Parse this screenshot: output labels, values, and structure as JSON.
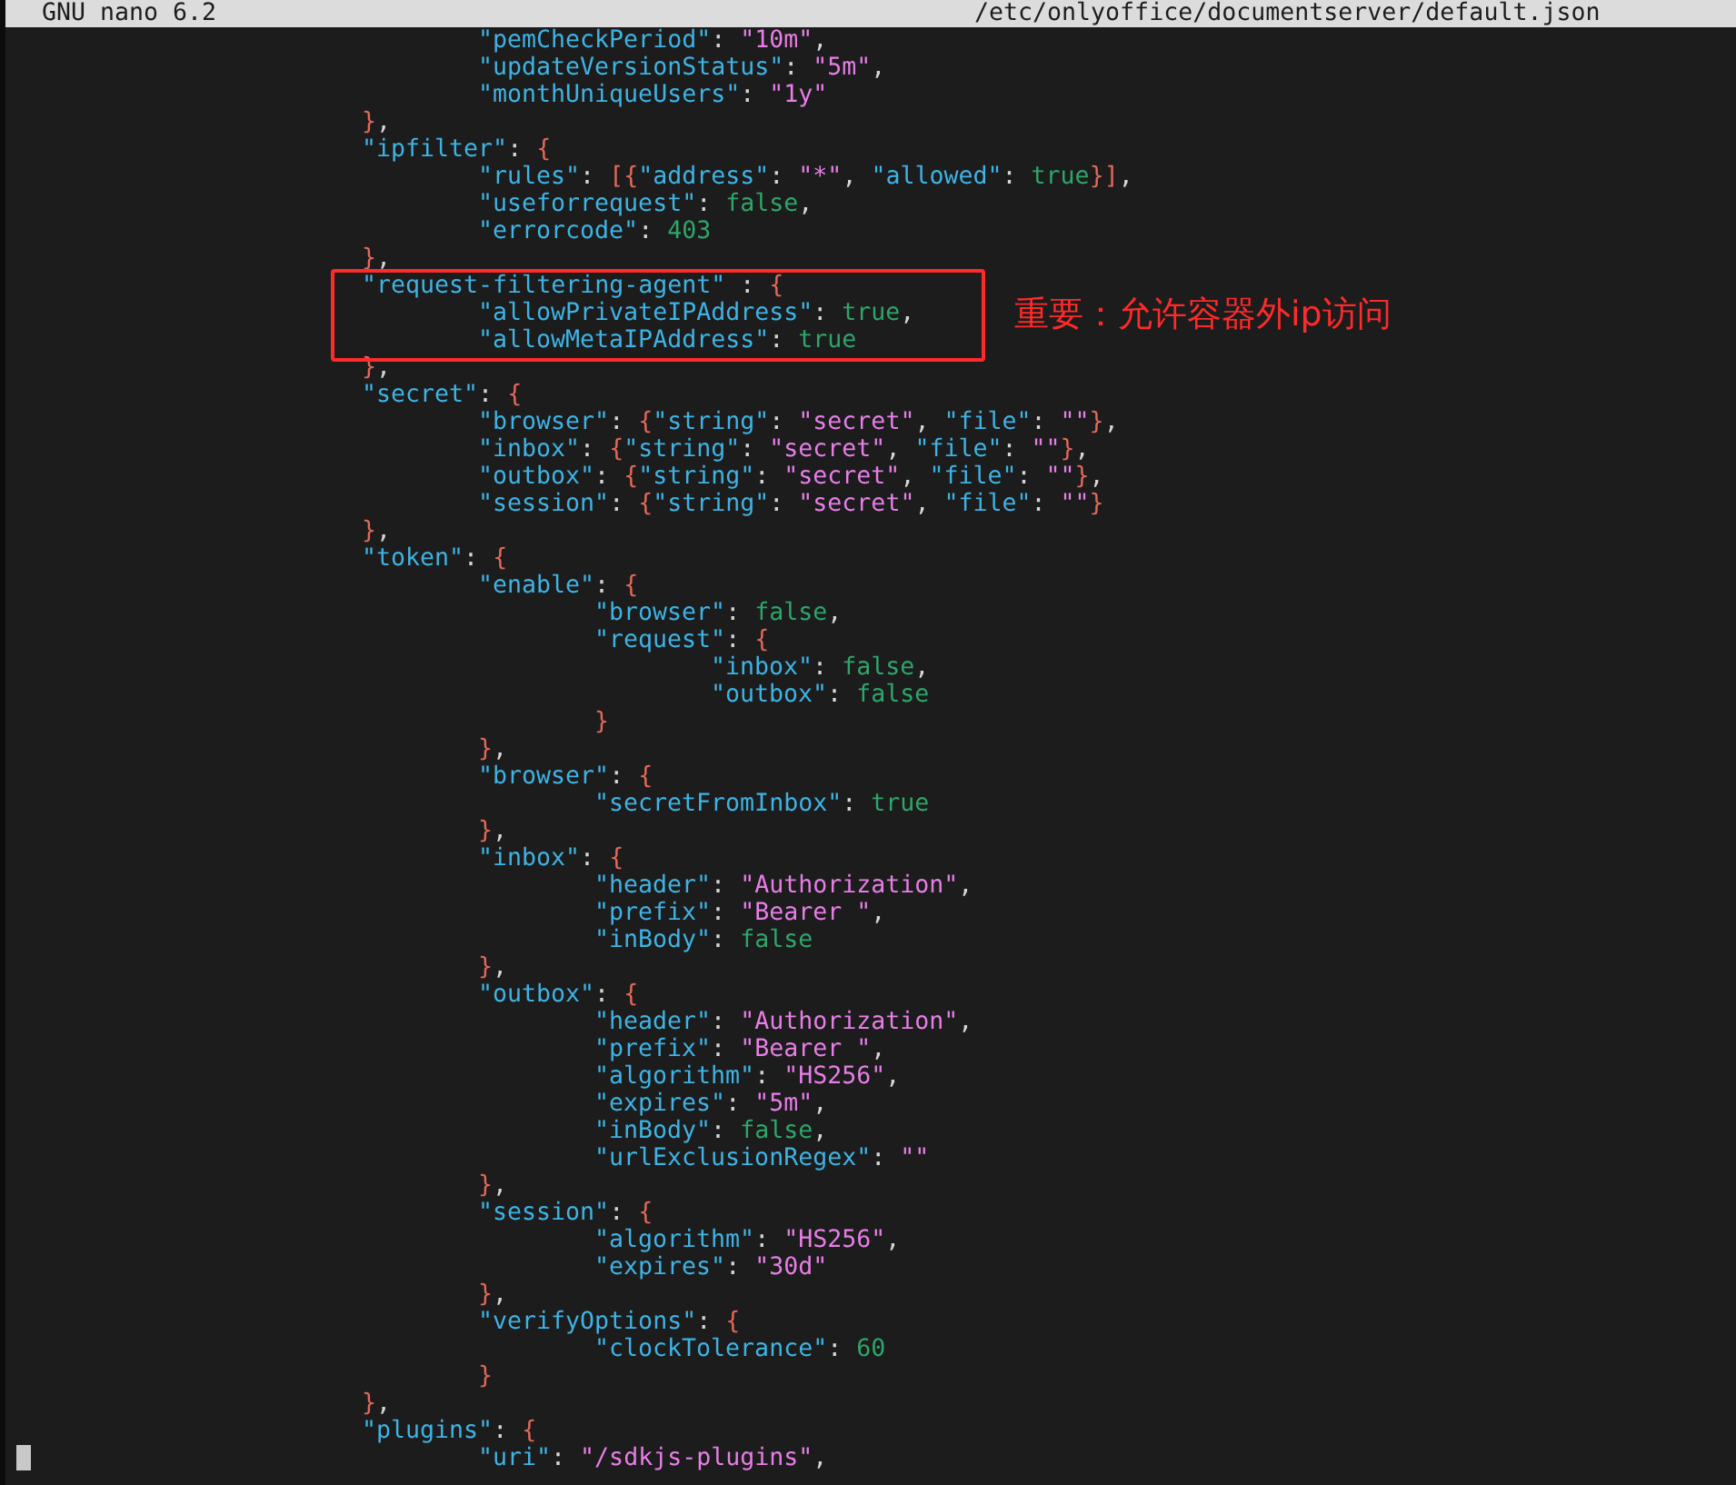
{
  "title_bar": {
    "app": "GNU nano 6.2",
    "file": "/etc/onlyoffice/documentserver/default.json"
  },
  "lines": [
    {
      "children": [
        {
          "tokens": [
            {
              "kind": "key",
              "text": "\"pemCheckPeriod\""
            },
            {
              "kind": "plain",
              "text": ": "
            },
            {
              "kind": "string",
              "text": "\"10m\""
            },
            {
              "kind": "plain",
              "text": ","
            }
          ]
        },
        {
          "tokens": [
            {
              "kind": "key",
              "text": "\"updateVersionStatus\""
            },
            {
              "kind": "plain",
              "text": ": "
            },
            {
              "kind": "string",
              "text": "\"5m\""
            },
            {
              "kind": "plain",
              "text": ","
            }
          ]
        },
        {
          "tokens": [
            {
              "kind": "key",
              "text": "\"monthUniqueUsers\""
            },
            {
              "kind": "plain",
              "text": ": "
            },
            {
              "kind": "string",
              "text": "\"1y\""
            }
          ]
        }
      ]
    },
    {
      "tokens": [
        {
          "kind": "brace",
          "text": "}"
        },
        {
          "kind": "plain",
          "text": ","
        }
      ]
    },
    {
      "tokens": [
        {
          "kind": "key",
          "text": "\"ipfilter\""
        },
        {
          "kind": "plain",
          "text": ": "
        },
        {
          "kind": "brace",
          "text": "{"
        }
      ],
      "children": [
        {
          "tokens": [
            {
              "kind": "key",
              "text": "\"rules\""
            },
            {
              "kind": "plain",
              "text": ": "
            },
            {
              "kind": "brace",
              "text": "[{"
            },
            {
              "kind": "key",
              "text": "\"address\""
            },
            {
              "kind": "plain",
              "text": ": "
            },
            {
              "kind": "string",
              "text": "\"*\""
            },
            {
              "kind": "plain",
              "text": ", "
            },
            {
              "kind": "key",
              "text": "\"allowed\""
            },
            {
              "kind": "plain",
              "text": ": "
            },
            {
              "kind": "literal",
              "text": "true"
            },
            {
              "kind": "brace",
              "text": "}]"
            },
            {
              "kind": "plain",
              "text": ","
            }
          ]
        },
        {
          "tokens": [
            {
              "kind": "key",
              "text": "\"useforrequest\""
            },
            {
              "kind": "plain",
              "text": ": "
            },
            {
              "kind": "literal",
              "text": "false"
            },
            {
              "kind": "plain",
              "text": ","
            }
          ]
        },
        {
          "tokens": [
            {
              "kind": "key",
              "text": "\"errorcode\""
            },
            {
              "kind": "plain",
              "text": ": "
            },
            {
              "kind": "literal",
              "text": "403"
            }
          ]
        }
      ]
    },
    {
      "tokens": [
        {
          "kind": "brace",
          "text": "}"
        },
        {
          "kind": "plain",
          "text": ","
        }
      ]
    },
    {
      "tokens": [
        {
          "kind": "key",
          "text": "\"request-filtering-agent\""
        },
        {
          "kind": "plain",
          "text": " : "
        },
        {
          "kind": "brace",
          "text": "{"
        }
      ],
      "children": [
        {
          "tokens": [
            {
              "kind": "key",
              "text": "\"allowPrivateIPAddress\""
            },
            {
              "kind": "plain",
              "text": ": "
            },
            {
              "kind": "literal",
              "text": "true"
            },
            {
              "kind": "plain",
              "text": ","
            }
          ]
        },
        {
          "tokens": [
            {
              "kind": "key",
              "text": "\"allowMetaIPAddress\""
            },
            {
              "kind": "plain",
              "text": ": "
            },
            {
              "kind": "literal",
              "text": "true"
            }
          ]
        }
      ]
    },
    {
      "tokens": [
        {
          "kind": "brace",
          "text": "}"
        },
        {
          "kind": "plain",
          "text": ","
        }
      ]
    },
    {
      "tokens": [
        {
          "kind": "key",
          "text": "\"secret\""
        },
        {
          "kind": "plain",
          "text": ": "
        },
        {
          "kind": "brace",
          "text": "{"
        }
      ],
      "children": [
        {
          "tokens": [
            {
              "kind": "key",
              "text": "\"browser\""
            },
            {
              "kind": "plain",
              "text": ": "
            },
            {
              "kind": "brace",
              "text": "{"
            },
            {
              "kind": "key",
              "text": "\"string\""
            },
            {
              "kind": "plain",
              "text": ": "
            },
            {
              "kind": "string",
              "text": "\"secret\""
            },
            {
              "kind": "plain",
              "text": ", "
            },
            {
              "kind": "key",
              "text": "\"file\""
            },
            {
              "kind": "plain",
              "text": ": "
            },
            {
              "kind": "string",
              "text": "\"\""
            },
            {
              "kind": "brace",
              "text": "}"
            },
            {
              "kind": "plain",
              "text": ","
            }
          ]
        },
        {
          "tokens": [
            {
              "kind": "key",
              "text": "\"inbox\""
            },
            {
              "kind": "plain",
              "text": ": "
            },
            {
              "kind": "brace",
              "text": "{"
            },
            {
              "kind": "key",
              "text": "\"string\""
            },
            {
              "kind": "plain",
              "text": ": "
            },
            {
              "kind": "string",
              "text": "\"secret\""
            },
            {
              "kind": "plain",
              "text": ", "
            },
            {
              "kind": "key",
              "text": "\"file\""
            },
            {
              "kind": "plain",
              "text": ": "
            },
            {
              "kind": "string",
              "text": "\"\""
            },
            {
              "kind": "brace",
              "text": "}"
            },
            {
              "kind": "plain",
              "text": ","
            }
          ]
        },
        {
          "tokens": [
            {
              "kind": "key",
              "text": "\"outbox\""
            },
            {
              "kind": "plain",
              "text": ": "
            },
            {
              "kind": "brace",
              "text": "{"
            },
            {
              "kind": "key",
              "text": "\"string\""
            },
            {
              "kind": "plain",
              "text": ": "
            },
            {
              "kind": "string",
              "text": "\"secret\""
            },
            {
              "kind": "plain",
              "text": ", "
            },
            {
              "kind": "key",
              "text": "\"file\""
            },
            {
              "kind": "plain",
              "text": ": "
            },
            {
              "kind": "string",
              "text": "\"\""
            },
            {
              "kind": "brace",
              "text": "}"
            },
            {
              "kind": "plain",
              "text": ","
            }
          ]
        },
        {
          "tokens": [
            {
              "kind": "key",
              "text": "\"session\""
            },
            {
              "kind": "plain",
              "text": ": "
            },
            {
              "kind": "brace",
              "text": "{"
            },
            {
              "kind": "key",
              "text": "\"string\""
            },
            {
              "kind": "plain",
              "text": ": "
            },
            {
              "kind": "string",
              "text": "\"secret\""
            },
            {
              "kind": "plain",
              "text": ", "
            },
            {
              "kind": "key",
              "text": "\"file\""
            },
            {
              "kind": "plain",
              "text": ": "
            },
            {
              "kind": "string",
              "text": "\"\""
            },
            {
              "kind": "brace",
              "text": "}"
            }
          ]
        }
      ]
    },
    {
      "tokens": [
        {
          "kind": "brace",
          "text": "}"
        },
        {
          "kind": "plain",
          "text": ","
        }
      ]
    },
    {
      "tokens": [
        {
          "kind": "key",
          "text": "\"token\""
        },
        {
          "kind": "plain",
          "text": ": "
        },
        {
          "kind": "brace",
          "text": "{"
        }
      ],
      "children": [
        {
          "tokens": [
            {
              "kind": "key",
              "text": "\"enable\""
            },
            {
              "kind": "plain",
              "text": ": "
            },
            {
              "kind": "brace",
              "text": "{"
            }
          ],
          "children": [
            {
              "tokens": [
                {
                  "kind": "key",
                  "text": "\"browser\""
                },
                {
                  "kind": "plain",
                  "text": ": "
                },
                {
                  "kind": "literal",
                  "text": "false"
                },
                {
                  "kind": "plain",
                  "text": ","
                }
              ]
            },
            {
              "tokens": [
                {
                  "kind": "key",
                  "text": "\"request\""
                },
                {
                  "kind": "plain",
                  "text": ": "
                },
                {
                  "kind": "brace",
                  "text": "{"
                }
              ],
              "children": [
                {
                  "tokens": [
                    {
                      "kind": "key",
                      "text": "\"inbox\""
                    },
                    {
                      "kind": "plain",
                      "text": ": "
                    },
                    {
                      "kind": "literal",
                      "text": "false"
                    },
                    {
                      "kind": "plain",
                      "text": ","
                    }
                  ]
                },
                {
                  "tokens": [
                    {
                      "kind": "key",
                      "text": "\"outbox\""
                    },
                    {
                      "kind": "plain",
                      "text": ": "
                    },
                    {
                      "kind": "literal",
                      "text": "false"
                    }
                  ]
                }
              ]
            },
            {
              "tokens": [
                {
                  "kind": "brace",
                  "text": "}"
                }
              ]
            }
          ]
        },
        {
          "tokens": [
            {
              "kind": "brace",
              "text": "}"
            },
            {
              "kind": "plain",
              "text": ","
            }
          ]
        },
        {
          "tokens": [
            {
              "kind": "key",
              "text": "\"browser\""
            },
            {
              "kind": "plain",
              "text": ": "
            },
            {
              "kind": "brace",
              "text": "{"
            }
          ],
          "children": [
            {
              "tokens": [
                {
                  "kind": "key",
                  "text": "\"secretFromInbox\""
                },
                {
                  "kind": "plain",
                  "text": ": "
                },
                {
                  "kind": "literal",
                  "text": "true"
                }
              ]
            }
          ]
        },
        {
          "tokens": [
            {
              "kind": "brace",
              "text": "}"
            },
            {
              "kind": "plain",
              "text": ","
            }
          ]
        },
        {
          "tokens": [
            {
              "kind": "key",
              "text": "\"inbox\""
            },
            {
              "kind": "plain",
              "text": ": "
            },
            {
              "kind": "brace",
              "text": "{"
            }
          ],
          "children": [
            {
              "tokens": [
                {
                  "kind": "key",
                  "text": "\"header\""
                },
                {
                  "kind": "plain",
                  "text": ": "
                },
                {
                  "kind": "string",
                  "text": "\"Authorization\""
                },
                {
                  "kind": "plain",
                  "text": ","
                }
              ]
            },
            {
              "tokens": [
                {
                  "kind": "key",
                  "text": "\"prefix\""
                },
                {
                  "kind": "plain",
                  "text": ": "
                },
                {
                  "kind": "string",
                  "text": "\"Bearer \""
                },
                {
                  "kind": "plain",
                  "text": ","
                }
              ]
            },
            {
              "tokens": [
                {
                  "kind": "key",
                  "text": "\"inBody\""
                },
                {
                  "kind": "plain",
                  "text": ": "
                },
                {
                  "kind": "literal",
                  "text": "false"
                }
              ]
            }
          ]
        },
        {
          "tokens": [
            {
              "kind": "brace",
              "text": "}"
            },
            {
              "kind": "plain",
              "text": ","
            }
          ]
        },
        {
          "tokens": [
            {
              "kind": "key",
              "text": "\"outbox\""
            },
            {
              "kind": "plain",
              "text": ": "
            },
            {
              "kind": "brace",
              "text": "{"
            }
          ],
          "children": [
            {
              "tokens": [
                {
                  "kind": "key",
                  "text": "\"header\""
                },
                {
                  "kind": "plain",
                  "text": ": "
                },
                {
                  "kind": "string",
                  "text": "\"Authorization\""
                },
                {
                  "kind": "plain",
                  "text": ","
                }
              ]
            },
            {
              "tokens": [
                {
                  "kind": "key",
                  "text": "\"prefix\""
                },
                {
                  "kind": "plain",
                  "text": ": "
                },
                {
                  "kind": "string",
                  "text": "\"Bearer \""
                },
                {
                  "kind": "plain",
                  "text": ","
                }
              ]
            },
            {
              "tokens": [
                {
                  "kind": "key",
                  "text": "\"algorithm\""
                },
                {
                  "kind": "plain",
                  "text": ": "
                },
                {
                  "kind": "string",
                  "text": "\"HS256\""
                },
                {
                  "kind": "plain",
                  "text": ","
                }
              ]
            },
            {
              "tokens": [
                {
                  "kind": "key",
                  "text": "\"expires\""
                },
                {
                  "kind": "plain",
                  "text": ": "
                },
                {
                  "kind": "string",
                  "text": "\"5m\""
                },
                {
                  "kind": "plain",
                  "text": ","
                }
              ]
            },
            {
              "tokens": [
                {
                  "kind": "key",
                  "text": "\"inBody\""
                },
                {
                  "kind": "plain",
                  "text": ": "
                },
                {
                  "kind": "literal",
                  "text": "false"
                },
                {
                  "kind": "plain",
                  "text": ","
                }
              ]
            },
            {
              "tokens": [
                {
                  "kind": "key",
                  "text": "\"urlExclusionRegex\""
                },
                {
                  "kind": "plain",
                  "text": ": "
                },
                {
                  "kind": "string",
                  "text": "\"\""
                }
              ]
            }
          ]
        },
        {
          "tokens": [
            {
              "kind": "brace",
              "text": "}"
            },
            {
              "kind": "plain",
              "text": ","
            }
          ]
        },
        {
          "tokens": [
            {
              "kind": "key",
              "text": "\"session\""
            },
            {
              "kind": "plain",
              "text": ": "
            },
            {
              "kind": "brace",
              "text": "{"
            }
          ],
          "children": [
            {
              "tokens": [
                {
                  "kind": "key",
                  "text": "\"algorithm\""
                },
                {
                  "kind": "plain",
                  "text": ": "
                },
                {
                  "kind": "string",
                  "text": "\"HS256\""
                },
                {
                  "kind": "plain",
                  "text": ","
                }
              ]
            },
            {
              "tokens": [
                {
                  "kind": "key",
                  "text": "\"expires\""
                },
                {
                  "kind": "plain",
                  "text": ": "
                },
                {
                  "kind": "string",
                  "text": "\"30d\""
                }
              ]
            }
          ]
        },
        {
          "tokens": [
            {
              "kind": "brace",
              "text": "}"
            },
            {
              "kind": "plain",
              "text": ","
            }
          ]
        },
        {
          "tokens": [
            {
              "kind": "key",
              "text": "\"verifyOptions\""
            },
            {
              "kind": "plain",
              "text": ": "
            },
            {
              "kind": "brace",
              "text": "{"
            }
          ],
          "children": [
            {
              "tokens": [
                {
                  "kind": "key",
                  "text": "\"clockTolerance\""
                },
                {
                  "kind": "plain",
                  "text": ": "
                },
                {
                  "kind": "literal",
                  "text": "60"
                }
              ]
            }
          ]
        },
        {
          "tokens": [
            {
              "kind": "brace",
              "text": "}"
            }
          ]
        }
      ]
    },
    {
      "tokens": [
        {
          "kind": "brace",
          "text": "}"
        },
        {
          "kind": "plain",
          "text": ","
        }
      ]
    },
    {
      "tokens": [
        {
          "kind": "key",
          "text": "\"plugins\""
        },
        {
          "kind": "plain",
          "text": ": "
        },
        {
          "kind": "brace",
          "text": "{"
        }
      ],
      "children": [
        {
          "tokens": [
            {
              "kind": "key",
              "text": "\"uri\""
            },
            {
              "kind": "plain",
              "text": ": "
            },
            {
              "kind": "string",
              "text": "\"/sdkjs-plugins\""
            },
            {
              "kind": "plain",
              "text": ","
            }
          ]
        }
      ]
    }
  ],
  "annotation": {
    "text": "重要：允许容器外ip访问"
  }
}
